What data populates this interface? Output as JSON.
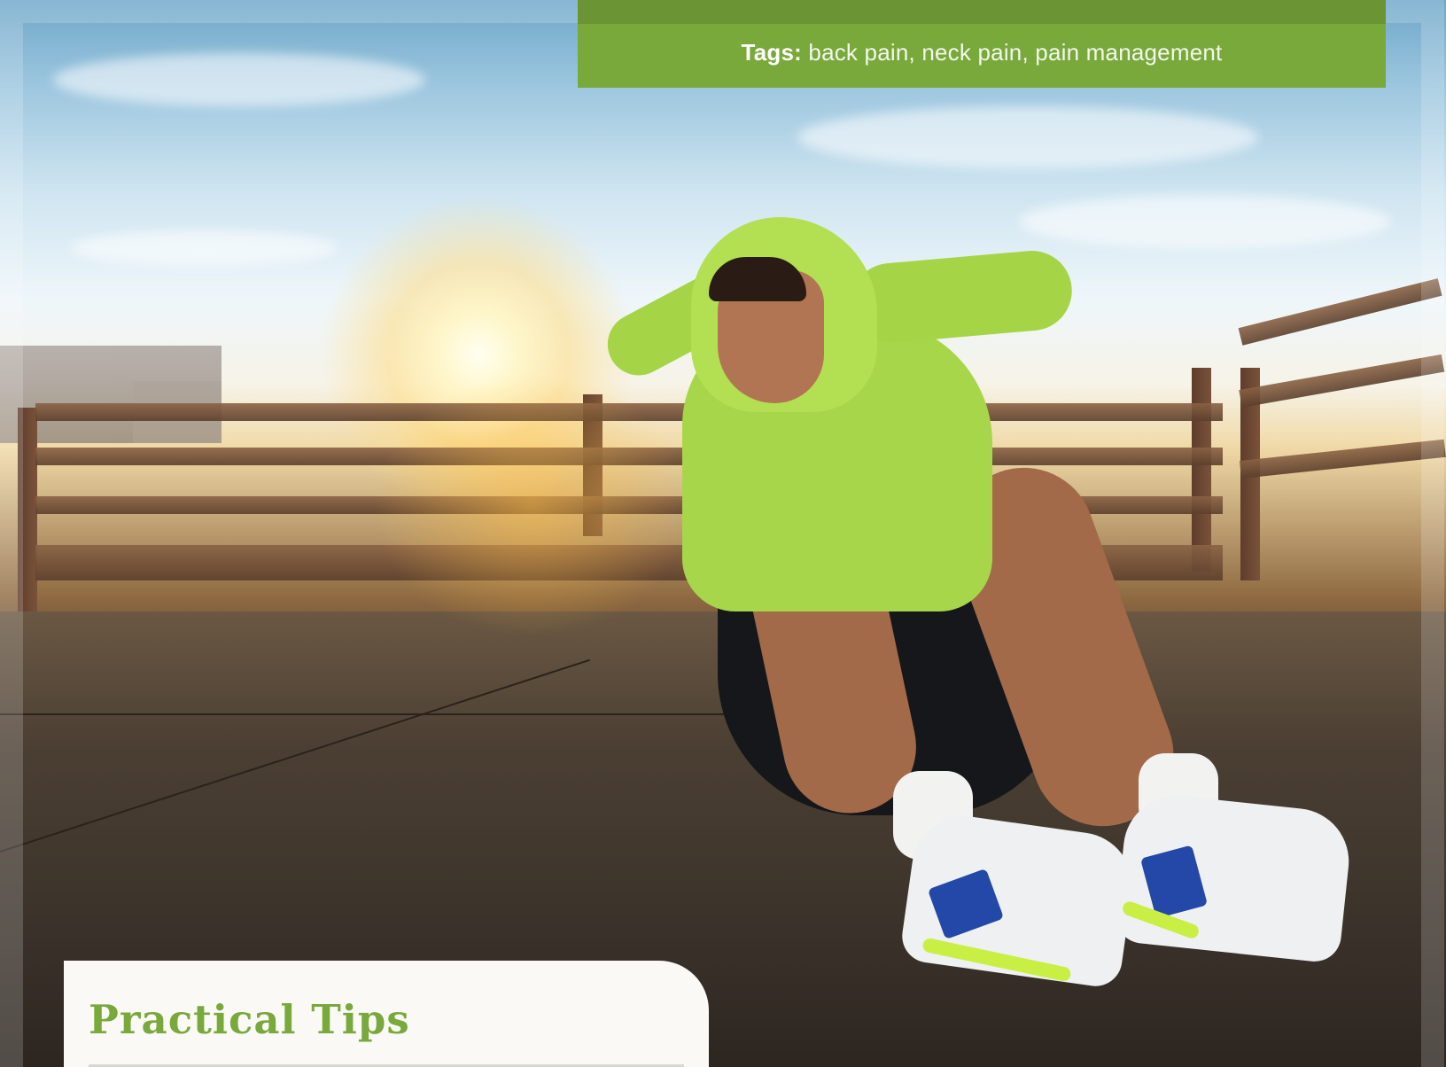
{
  "tags": {
    "label": "Tags:",
    "values": "back pain, neck pain, pain management"
  },
  "tips": {
    "title": "Practical Tips"
  },
  "photo": {
    "subject": "man in green hoodie doing sit-ups outdoors at sunrise"
  },
  "colors": {
    "brand_green": "#79a83b",
    "brand_green_dark": "#6b9534",
    "card_background": "#faf9f6"
  }
}
